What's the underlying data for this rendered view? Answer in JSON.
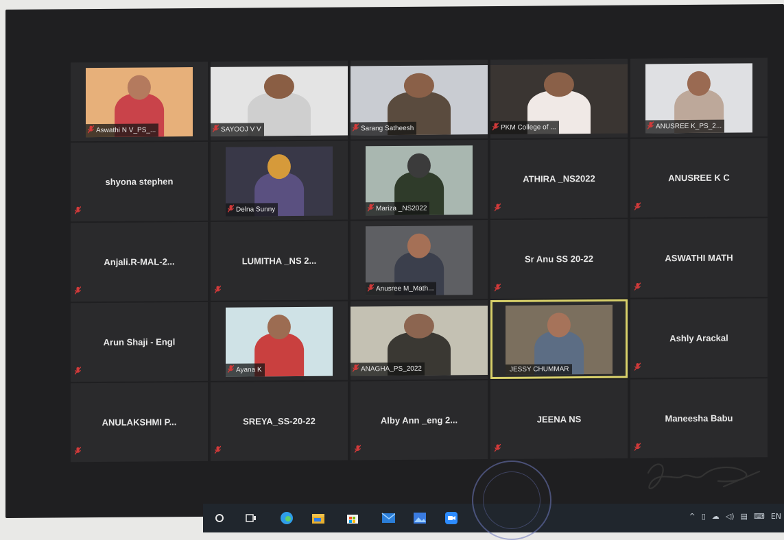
{
  "participants": [
    {
      "name": "Aswathi N V_PS_...",
      "video": true,
      "bg": "#c9434a",
      "skin": "#b47a5e",
      "wall": "#e7b07a"
    },
    {
      "name": "SAYOOJ V V",
      "video": true,
      "full": true,
      "bg": "#cfcfcf",
      "skin": "#8a5e44",
      "wall": "#e4e4e4"
    },
    {
      "name": "Sarang Satheesh",
      "video": true,
      "full": true,
      "bg": "#5a4b3e",
      "skin": "#8a6048",
      "wall": "#c9ccd2"
    },
    {
      "name": "PKM College of ...",
      "video": true,
      "full": true,
      "bg": "#f0e9e6",
      "skin": "#8a6048",
      "wall": "#3a3532"
    },
    {
      "name": "ANUSREE K_PS_2...",
      "video": true,
      "bg": "#bda89a",
      "skin": "#9a6a52",
      "wall": "#dfe0e3"
    },
    {
      "name": "shyona stephen",
      "video": false
    },
    {
      "name": "Delna Sunny",
      "video": true,
      "bg": "#5a5080",
      "skin": "#d69a3a",
      "wall": "#393848"
    },
    {
      "name": "Mariza _NS2022",
      "video": true,
      "bg": "#2f3b2a",
      "skin": "#3b3b3b",
      "wall": "#a9b7b0"
    },
    {
      "name": "ATHIRA _NS2022",
      "video": false
    },
    {
      "name": "ANUSREE K C",
      "video": false
    },
    {
      "name": "Anjali.R-MAL-2...",
      "video": false
    },
    {
      "name": "LUMITHA _NS 2...",
      "video": false
    },
    {
      "name": "Anusree M_Math...",
      "video": true,
      "bg": "#3b3f4c",
      "skin": "#a57056",
      "wall": "#5e5f63"
    },
    {
      "name": "Sr Anu SS 20-22",
      "video": false
    },
    {
      "name": "ASWATHI MATH",
      "video": false
    },
    {
      "name": "Arun Shaji - Engl",
      "video": false
    },
    {
      "name": "Ayana K",
      "video": true,
      "bg": "#c9403f",
      "skin": "#9c6c52",
      "wall": "#cfe2e6"
    },
    {
      "name": "ANAGHA_PS_2022",
      "video": true,
      "full": true,
      "bg": "#3a3833",
      "skin": "#8c6550",
      "wall": "#c4c1b3"
    },
    {
      "name": "JESSY CHUMMAR",
      "video": true,
      "active": true,
      "bg": "#5c6d84",
      "skin": "#a6735a",
      "wall": "#7b6f5e"
    },
    {
      "name": "Ashly Arackal",
      "video": false
    },
    {
      "name": "ANULAKSHMI P...",
      "video": false
    },
    {
      "name": "SREYA_SS-20-22",
      "video": false
    },
    {
      "name": "Alby Ann _eng 2...",
      "video": false
    },
    {
      "name": "JEENA NS",
      "video": false
    },
    {
      "name": "Maneesha Babu",
      "video": false
    }
  ],
  "taskbar": {
    "icons": [
      "search-circle-icon",
      "task-view-icon",
      "edge-browser-icon",
      "file-explorer-icon",
      "store-icon",
      "mail-icon",
      "photos-icon",
      "zoom-app-icon"
    ],
    "tray_lang": "EN"
  },
  "colors": {
    "mute": "#d23a3a",
    "active_border": "#d8d06a",
    "taskbar_bg": "#20262d"
  }
}
